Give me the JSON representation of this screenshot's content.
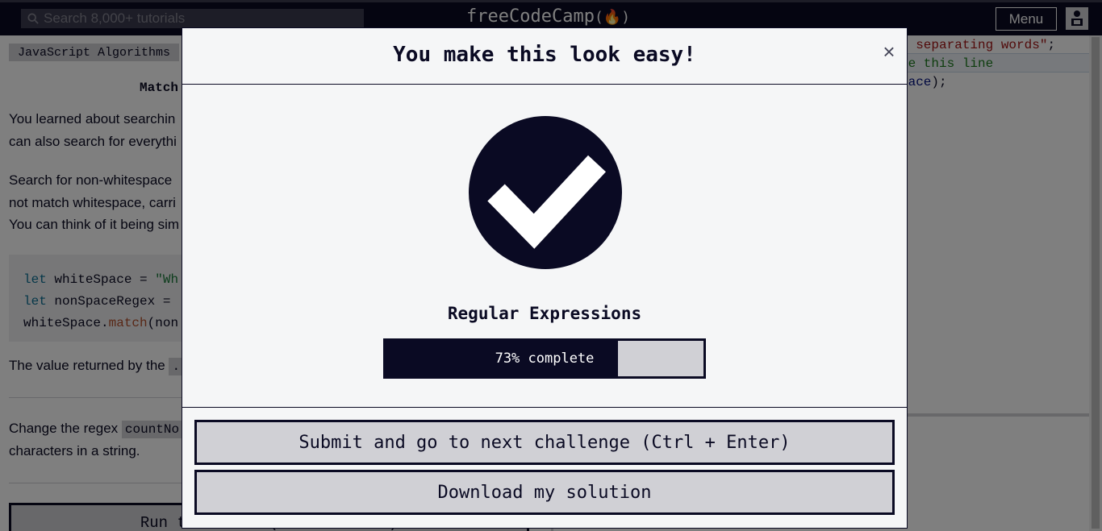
{
  "nav": {
    "search_placeholder": "Search 8,000+ tutorials",
    "brand": "freeCodeCamp",
    "brand_icon": "(🔥)",
    "menu_label": "Menu",
    "colors": {
      "nav_bg": "#0a0a23",
      "search_bg": "#3b3b4f"
    }
  },
  "lesson": {
    "breadcrumb": "JavaScript Algorithms",
    "title": "Match",
    "para1_line1": "You learned about searchin",
    "para1_line2": "can also search for everythi",
    "para2_line1": "Search for non-whitespace",
    "para2_line2": "not match whitespace, carri",
    "para2_line3": "You can think of it being sim",
    "code": {
      "line1": {
        "kw": "let",
        "rest": " whiteSpace = ",
        "str": "\"Wh"
      },
      "line2": {
        "kw": "let",
        "rest": " nonSpaceRegex = "
      },
      "line3": {
        "obj": "whiteSpace.",
        "fn": "match",
        "rest": "(non"
      }
    },
    "para3": "The value returned by the",
    "para4_prefix": "Change the regex",
    "para4_code": "countNo",
    "para4_line2": "characters in a string.",
    "run_button": "Run the Tests (Ctrl + Enter)"
  },
  "editor": {
    "line1_str": "n separating words\"",
    "line1_end": ";",
    "line2_com": "ge this line",
    "line3_id": "pace",
    "line3_end": ");"
  },
  "modal": {
    "title": "You make this look easy!",
    "close_label": "×",
    "superblock": "Regular Expressions",
    "progress_percent": 73,
    "progress_text": "73% complete",
    "submit_button": "Submit and go to next challenge (Ctrl + Enter)",
    "download_button": "Download my solution",
    "icon": "check-circle-icon",
    "colors": {
      "accent": "#0a0a23",
      "modal_bg": "#f5f6f7",
      "button_bg": "#d0d0d5"
    }
  }
}
